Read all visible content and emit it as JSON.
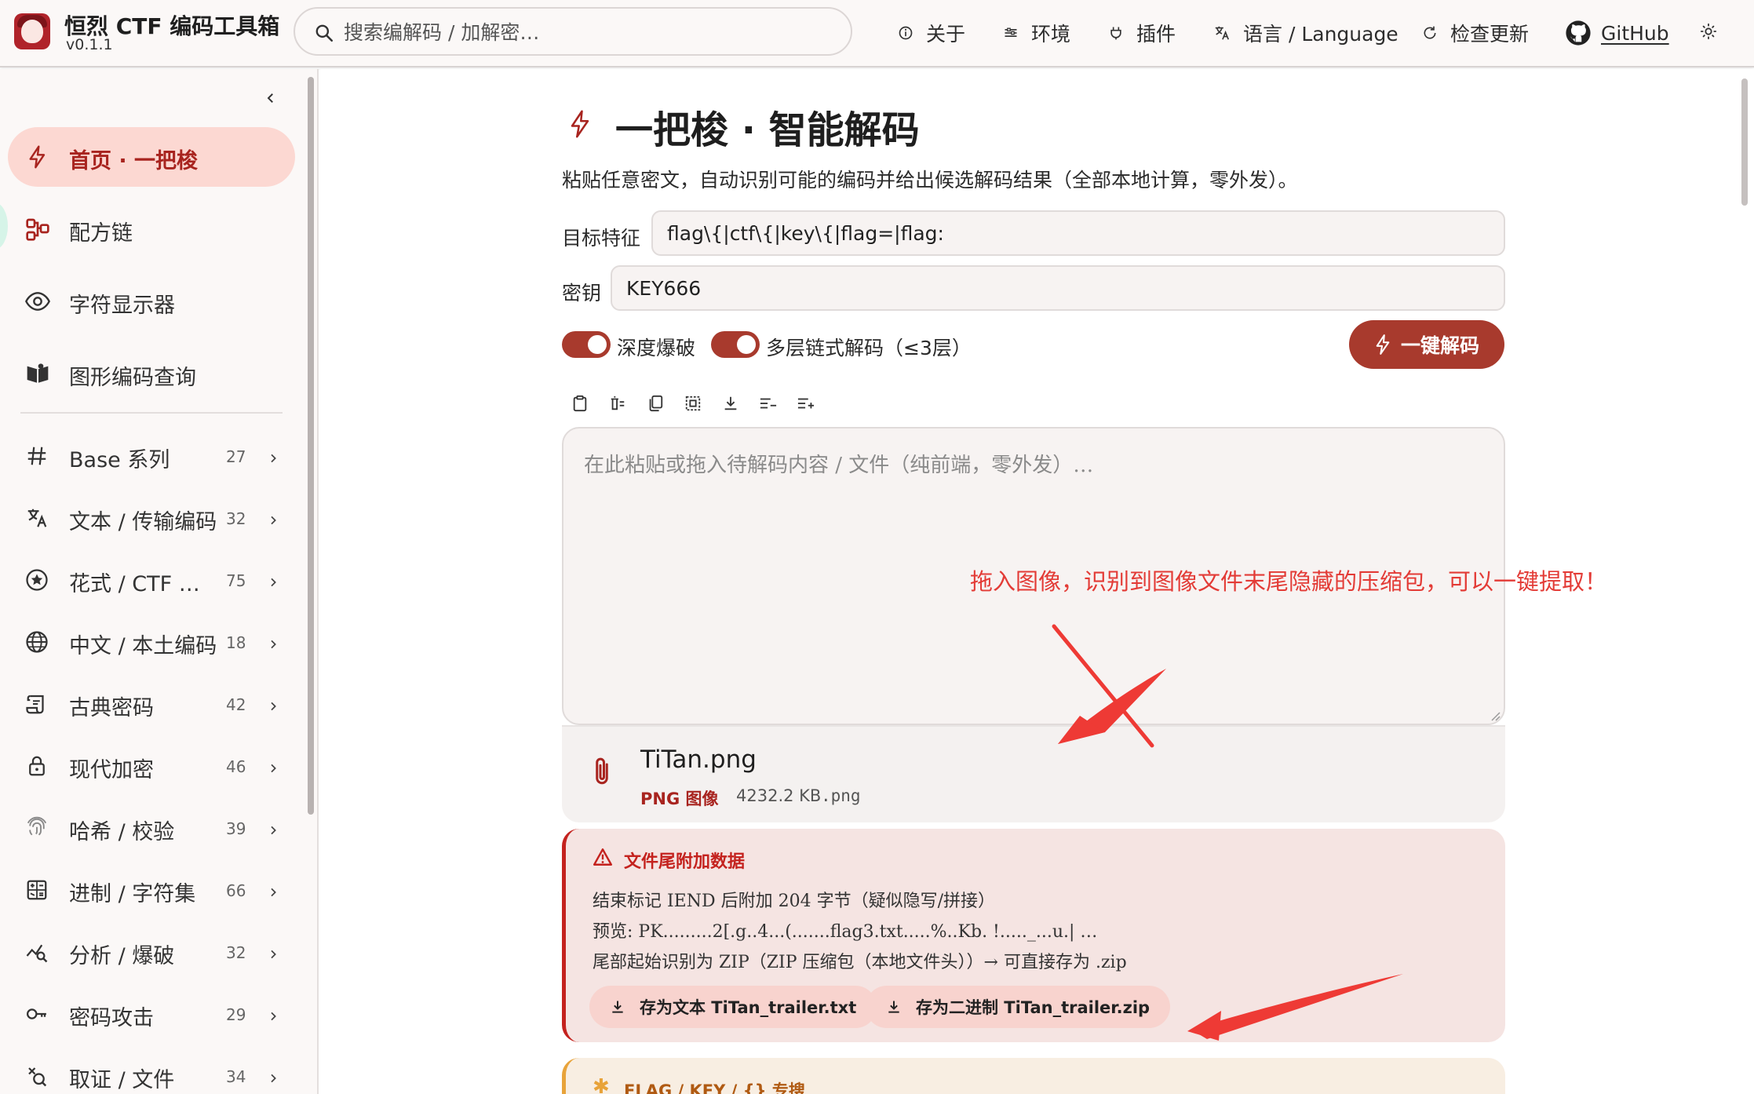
{
  "app": {
    "title": "恒烈 CTF 编码工具箱",
    "version": "v0.1.1"
  },
  "search": {
    "placeholder": "搜索编解码 / 加解密…"
  },
  "nav": {
    "about": "关于",
    "env": "环境",
    "plugins": "插件",
    "language": "语言 / Language",
    "update": "检查更新",
    "github": "GitHub"
  },
  "sidebar": {
    "items": [
      {
        "label": "首页 · 一把梭",
        "icon": "bolt-icon",
        "active": true
      },
      {
        "label": "配方链",
        "icon": "workflow-icon"
      },
      {
        "label": "字符显示器",
        "icon": "eye-icon"
      },
      {
        "label": "图形编码查询",
        "icon": "book-icon"
      }
    ],
    "categories": [
      {
        "label": "Base 系列",
        "count": "27",
        "icon": "hash-icon"
      },
      {
        "label": "文本 / 传输编码",
        "count": "32",
        "icon": "translate-icon"
      },
      {
        "label": "花式 / CTF 编码",
        "count": "75",
        "icon": "star-icon"
      },
      {
        "label": "中文 / 本土编码",
        "count": "18",
        "icon": "globe-icon"
      },
      {
        "label": "古典密码",
        "count": "42",
        "icon": "scroll-icon"
      },
      {
        "label": "现代加密",
        "count": "46",
        "icon": "lock-icon"
      },
      {
        "label": "哈希 / 校验",
        "count": "39",
        "icon": "fingerprint-icon"
      },
      {
        "label": "进制 / 字符集",
        "count": "66",
        "icon": "calculator-icon"
      },
      {
        "label": "分析 / 爆破",
        "count": "32",
        "icon": "analytics-icon"
      },
      {
        "label": "密码攻击",
        "count": "29",
        "icon": "key-icon"
      },
      {
        "label": "取证 / 文件",
        "count": "34",
        "icon": "forensics-icon"
      }
    ]
  },
  "main": {
    "title": "一把梭 · 智能解码",
    "description": "粘贴任意密文，自动识别可能的编码并给出候选解码结果（全部本地计算，零外发）。",
    "target_label": "目标特征",
    "target_value": "flag\\{|ctf\\{|key\\{|flag=|flag:",
    "key_label": "密钥",
    "key_value": "KEY666",
    "toggle_deep": "深度爆破",
    "toggle_chain": "多层链式解码（≤3层）",
    "decode_button": "一键解码",
    "input_placeholder": "在此粘贴或拖入待解码内容 / 文件（纯前端，零外发）…",
    "annotation": "拖入图像，识别到图像文件末尾隐藏的压缩包，可以一键提取！"
  },
  "file": {
    "name": "TiTan.png",
    "type": "PNG 图像",
    "size": "4232.2 KB",
    "ext": ".png"
  },
  "trailer": {
    "title": "文件尾附加数据",
    "line1": "结束标记 IEND 后附加 204 字节（疑似隐写/拼接）",
    "line2": "预览: PK.........2[.g..4...(.......flag3.txt.....%..Kb. !....._...u.| …",
    "line3": "尾部起始识别为 ZIP（ZIP 压缩包（本地文件头））→ 可直接存为 .zip",
    "save_text": "存为文本 TiTan_trailer.txt",
    "save_binary": "存为二进制 TiTan_trailer.zip"
  },
  "next_section": {
    "title": "FLAG / KEY / {} 专搜"
  },
  "colors": {
    "accent": "#a83a2d",
    "alert": "#c4221e",
    "annotation": "#e33b36",
    "active_bg": "#fcd8d2"
  }
}
